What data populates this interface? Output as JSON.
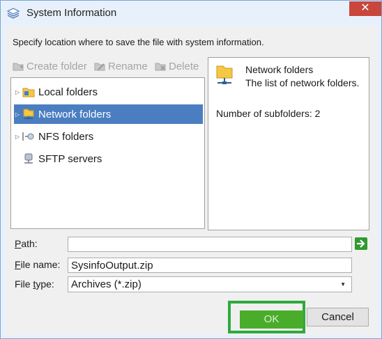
{
  "window": {
    "title": "System Information",
    "close_symbol": "✕"
  },
  "intro": "Specify location where to save the file with system information.",
  "toolbar": {
    "create_folder": "Create folder",
    "rename": "Rename",
    "delete": "Delete"
  },
  "tree": {
    "items": [
      {
        "label": "Local folders",
        "icon": "local-folder-icon",
        "expandable": true,
        "selected": false
      },
      {
        "label": "Network folders",
        "icon": "network-folder-icon",
        "expandable": true,
        "selected": true
      },
      {
        "label": "NFS folders",
        "icon": "nfs-folder-icon",
        "expandable": true,
        "selected": false
      },
      {
        "label": "SFTP servers",
        "icon": "sftp-server-icon",
        "expandable": false,
        "selected": false
      }
    ]
  },
  "info": {
    "title": "Network folders",
    "description": "The list of network folders.",
    "subfolders": "Number of subfolders: 2"
  },
  "form": {
    "path_label_first": "P",
    "path_label_rest": "ath:",
    "path_value": "",
    "filename_label_first": "F",
    "filename_label_rest": "ile name:",
    "filename_value": "SysinfoOutput.zip",
    "filetype_label_first": "File ",
    "filetype_label_under": "t",
    "filetype_label_rest": "ype:",
    "filetype_value": "Archives (*.zip)"
  },
  "buttons": {
    "ok": "OK",
    "cancel": "Cancel"
  },
  "colors": {
    "selection": "#4b7ec1",
    "ok_green": "#49ad2b",
    "highlight_frame": "#2eaa3c",
    "close_red": "#c9463d"
  }
}
